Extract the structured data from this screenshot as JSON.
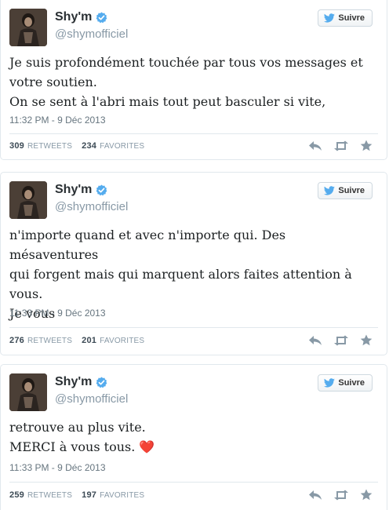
{
  "tweets": [
    {
      "name": "Shy'm",
      "handle": "@shymofficiel",
      "follow_label": "Suivre",
      "lines": [
        "Je suis profondément touchée par tous vos messages et",
        "votre soutien.",
        "On se sent à l'abri mais tout peut basculer si vite,"
      ],
      "timestamp": "11:32 PM - 9 Déc 2013",
      "retweets": "309",
      "retweets_label": "RETWEETS",
      "favorites": "234",
      "favorites_label": "FAVORITES"
    },
    {
      "name": "Shy'm",
      "handle": "@shymofficiel",
      "follow_label": "Suivre",
      "lines": [
        "n'importe quand et avec n'importe qui. Des mésaventures",
        "qui forgent mais qui marquent alors faites attention à",
        "vous.",
        "Je vous"
      ],
      "timestamp": "11:33 PM - 9 Déc 2013",
      "retweets": "276",
      "retweets_label": "RETWEETS",
      "favorites": "201",
      "favorites_label": "FAVORITES"
    },
    {
      "name": "Shy'm",
      "handle": "@shymofficiel",
      "follow_label": "Suivre",
      "lines": [
        "retrouve au plus vite.",
        "MERCI à vous tous."
      ],
      "emoji": "❤️",
      "timestamp": "11:33 PM - 9 Déc 2013",
      "retweets": "259",
      "retweets_label": "RETWEETS",
      "favorites": "197",
      "favorites_label": "FAVORITES"
    }
  ],
  "colors": {
    "verified": "#55acee",
    "bird": "#55acee",
    "meta": "#8899a6"
  }
}
